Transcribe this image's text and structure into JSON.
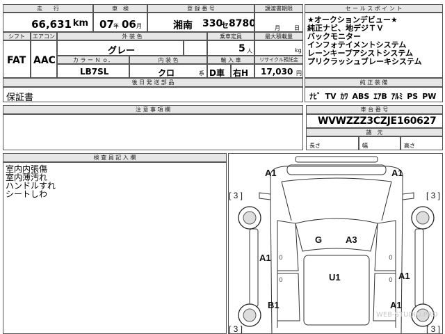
{
  "header": {
    "mileage_label": "走　　行",
    "mileage_value": "66,631",
    "mileage_unit": "km",
    "inspection_label": "車　検",
    "inspection_year": "07",
    "inspection_year_unit": "年",
    "inspection_month": "06",
    "inspection_month_unit": "月",
    "registration_label": "登 録 番 号",
    "registration_region": "湘南",
    "registration_class": "330",
    "registration_kana": "セ",
    "registration_number": "8780",
    "transfer_deadline_label": "譲渡書期限",
    "transfer_month_unit": "月",
    "transfer_day_unit": "日"
  },
  "specs": {
    "shift_label": "シフト",
    "shift_value": "FAT",
    "aircon_label": "エアコン",
    "aircon_value": "AAC",
    "exterior_color_label": "外 装 色",
    "exterior_color_value": "グレー",
    "capacity_label": "乗車定員",
    "capacity_value": "5",
    "capacity_unit": "人",
    "max_load_label": "最大積載量",
    "max_load_unit": "kg",
    "color_no_label": "カ ラ ー Ｎ ｏ．",
    "color_no_value": "LB7SL",
    "interior_color_label": "内 装 色",
    "interior_color_value": "クロ",
    "interior_color_unit": "系",
    "import_label": "輸 入 車",
    "import_value": "D車",
    "handle_value": "右H",
    "recycle_label": "リサイクル預託金",
    "recycle_value": "17,030",
    "recycle_unit": "円",
    "later_docs_label": "後 日 発 送 部 品",
    "later_docs_value": "保証書"
  },
  "sales_points": {
    "label": "セ ー ル ス ポ イ ン ト",
    "lines": [
      "★オークションデビュー★",
      "純正ナビ、地デジＴＶ",
      "バックモニター",
      "インフォテイメントシステム",
      "レーンキープアシストシステム",
      "プリクラッシュブレーキシステム"
    ]
  },
  "equipment": {
    "label": "純 正 装 備",
    "items": [
      "ﾅﾋﾞ",
      "TV",
      "ｶﾜ",
      "ABS",
      "ｴｱB",
      "ｱﾙﾐ",
      "PS",
      "PW"
    ]
  },
  "notes": {
    "label": "注 意 事 項 欄"
  },
  "chassis": {
    "label": "車 台 番 号",
    "value": "WVWZZZ3CZJE160627",
    "dims_label": "諸　元",
    "length_label": "長さ",
    "width_label": "幅",
    "height_label": "高さ"
  },
  "inspector": {
    "label": "検 査 員 記 入 欄",
    "lines": [
      "室内内張傷",
      "室内薄汚れ",
      "ハンドルすれ",
      "シートしわ"
    ]
  },
  "diagram": {
    "marks": [
      "A1",
      "A1",
      "[ 3 ]",
      "[ 3 ]",
      "G",
      "A3",
      "A1",
      "U1",
      "A1",
      "B1",
      "A1",
      "[ 3 ]",
      "[ 3 ]"
    ]
  },
  "watermark": "WEB-STUDIO.PRO"
}
